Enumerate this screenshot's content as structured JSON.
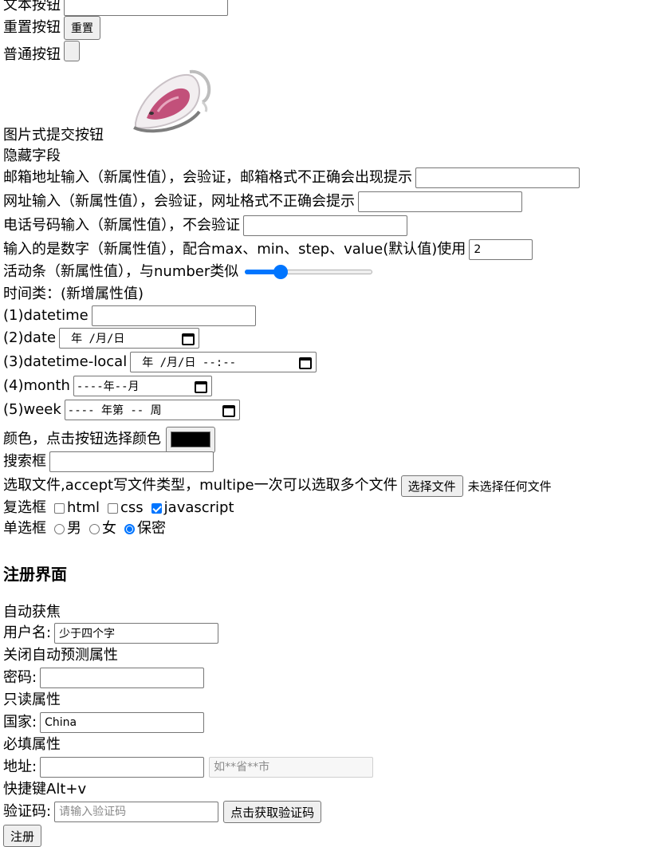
{
  "text_field": {
    "label": "文本按钮",
    "value": ""
  },
  "reset": {
    "label": "重置按钮",
    "button": "重置"
  },
  "plain": {
    "label": "普通按钮",
    "button": ""
  },
  "image_submit": {
    "label": "图片式提交按钮",
    "image": "clothes-iron-icon"
  },
  "hidden_field": {
    "label": "隐藏字段"
  },
  "email": {
    "label": "邮箱地址输入（新属性值），会验证，邮箱格式不正确会出现提示",
    "value": ""
  },
  "url": {
    "label": "网址输入（新属性值），会验证，网址格式不正确会提示",
    "value": ""
  },
  "tel": {
    "label": "电话号码输入（新属性值），不会验证",
    "value": ""
  },
  "number": {
    "label": "输入的是数字（新属性值），配合max、min、step、value(默认值)使用",
    "value": "2"
  },
  "range": {
    "label": "活动条（新属性值），与number类似",
    "level": 0.28
  },
  "time_group": {
    "label": "时间类：(新增属性值)",
    "datetime": {
      "label": "(1)datetime",
      "value": ""
    },
    "date": {
      "label": "(2)date",
      "value": "年 /月/日"
    },
    "datetime_local": {
      "label": "(3)datetime-local",
      "value": "年 /月/日 --:--"
    },
    "month": {
      "label": "(4)month",
      "value": "----年--月"
    },
    "week": {
      "label": "(5)week",
      "value": "---- 年第 -- 周"
    }
  },
  "color": {
    "label": "颜色，点击按钮选择颜色",
    "value": "#000000"
  },
  "search": {
    "label": "搜索框",
    "value": ""
  },
  "file": {
    "label": "选取文件,accept写文件类型，multipe一次可以选取多个文件",
    "button": "选择文件",
    "status": "未选择任何文件"
  },
  "checkboxes": {
    "label": "复选框",
    "items": [
      {
        "label": "html",
        "checked": false
      },
      {
        "label": "css",
        "checked": false
      },
      {
        "label": "javascript",
        "checked": true
      }
    ]
  },
  "radios": {
    "label": "单选框",
    "items": [
      {
        "label": "男",
        "checked": false
      },
      {
        "label": "女",
        "checked": false
      },
      {
        "label": "保密",
        "checked": true
      }
    ]
  },
  "register": {
    "heading": "注册界面",
    "autofocus_note": "自动获焦",
    "username": {
      "label": "用户名:",
      "value": "少于四个字"
    },
    "autocomplete_note": "关闭自动预测属性",
    "password": {
      "label": "密码:",
      "value": ""
    },
    "readonly_note": "只读属性",
    "country": {
      "label": "国家:",
      "value": "China"
    },
    "required_note": "必填属性",
    "address": {
      "label": "地址:",
      "value": "",
      "placeholder": "如**省**市"
    },
    "accesskey_note": "快捷键Alt+v",
    "code": {
      "label": "验证码:",
      "placeholder": "请输入验证码",
      "button": "点击获取验证码"
    },
    "submit": "注册"
  }
}
